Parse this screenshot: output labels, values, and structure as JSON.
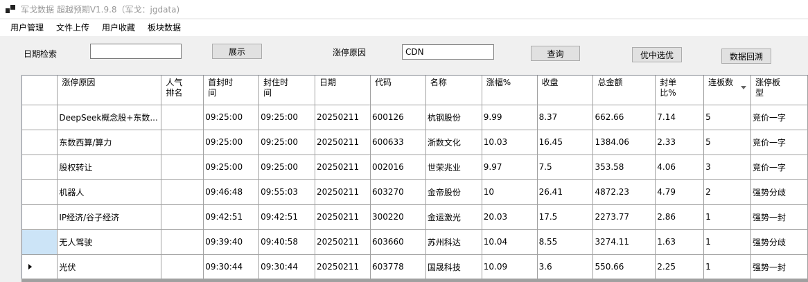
{
  "window": {
    "title": "军戈数据 超越预期V1.9.8（军戈：jgdata)"
  },
  "menu": [
    "用户管理",
    "文件上传",
    "用户收藏",
    "板块数据"
  ],
  "toolbar": {
    "date_label": "日期检索",
    "date_value": "",
    "show_button": "展示",
    "reason_label": "涨停原因",
    "reason_value": "CDN",
    "query_button": "查询",
    "select_button": "优中选优",
    "backtrack_button": "数据回溯"
  },
  "grid": {
    "columns": [
      "涨停原因",
      "人气排名",
      "首封时间",
      "封住时间",
      "日期",
      "代码",
      "名称",
      "涨幅%",
      "收盘",
      "总金额",
      "封单比%",
      "连板数",
      "涨停板型"
    ],
    "columns_display": [
      [
        "涨停原因"
      ],
      [
        "人气",
        "排名"
      ],
      [
        "首封时",
        "间"
      ],
      [
        "封住时",
        "间"
      ],
      [
        "日期"
      ],
      [
        "代码"
      ],
      [
        "名称"
      ],
      [
        "涨幅%"
      ],
      [
        "收盘"
      ],
      [
        "总金额"
      ],
      [
        "封单",
        "比%"
      ],
      [
        "连板数"
      ],
      [
        "涨停板",
        "型"
      ]
    ],
    "sorted_column": "连板数",
    "rows": [
      [
        "DeepSeek概念股+东数...",
        "",
        "09:25:00",
        "09:25:00",
        "20250211",
        "600126",
        "杭钢股份",
        "9.99",
        "8.37",
        "662.66",
        "7.14",
        "5",
        "竞价一字"
      ],
      [
        "东数西算/算力",
        "",
        "09:25:00",
        "09:25:00",
        "20250211",
        "600633",
        "浙数文化",
        "10.03",
        "16.45",
        "1384.06",
        "2.33",
        "5",
        "竞价一字"
      ],
      [
        "股权转让",
        "",
        "09:25:00",
        "09:25:00",
        "20250211",
        "002016",
        "世荣兆业",
        "9.97",
        "7.5",
        "353.58",
        "4.06",
        "3",
        "竞价一字"
      ],
      [
        "机器人",
        "",
        "09:46:48",
        "09:55:03",
        "20250211",
        "603270",
        "金帝股份",
        "10",
        "26.41",
        "4872.23",
        "4.79",
        "2",
        "强势分歧"
      ],
      [
        "IP经济/谷子经济",
        "",
        "09:42:51",
        "09:42:51",
        "20250211",
        "300220",
        "金运激光",
        "20.03",
        "17.5",
        "2273.77",
        "2.86",
        "1",
        "强势一封"
      ],
      [
        "无人驾驶",
        "",
        "09:39:40",
        "09:40:58",
        "20250211",
        "603660",
        "苏州科达",
        "10.04",
        "8.55",
        "3274.11",
        "1.63",
        "1",
        "强势分歧"
      ],
      [
        "光伏",
        "",
        "09:30:44",
        "09:30:44",
        "20250211",
        "603778",
        "国晟科技",
        "10.09",
        "3.6",
        "550.66",
        "2.25",
        "1",
        "强势一封"
      ]
    ],
    "selected_row_header": 5,
    "current_row": 6
  }
}
